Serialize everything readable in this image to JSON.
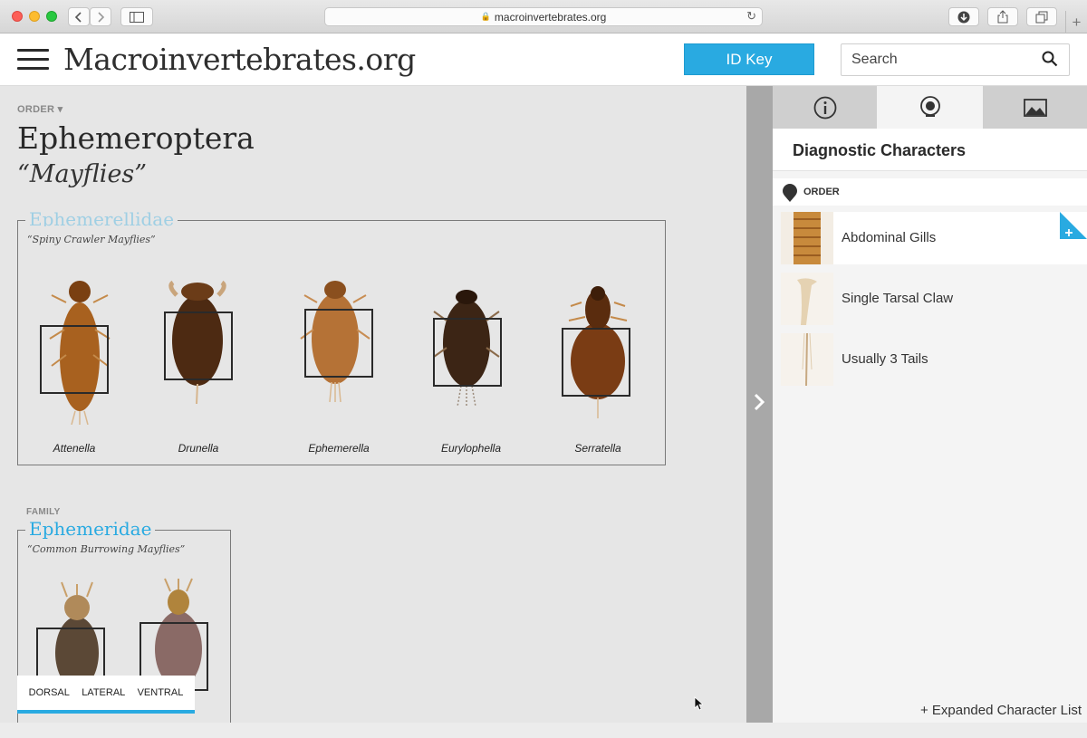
{
  "browser": {
    "url": "macroinvertebrates.org"
  },
  "header": {
    "site_title": "Macroinvertebrates.org",
    "id_key_label": "ID Key",
    "search_placeholder": "Search",
    "accent": "#29aae1"
  },
  "main": {
    "order_label": "ORDER",
    "order_name": "Ephemeroptera",
    "order_common": "“Mayflies”",
    "families": [
      {
        "label": "",
        "name": "Ephemerellidae",
        "common": "“Spiny Crawler Mayflies”",
        "genera": [
          "Attenella",
          "Drunella",
          "Ephemerella",
          "Eurylophella",
          "Serratella"
        ]
      },
      {
        "label": "FAMILY",
        "name": "Ephemeridae",
        "common": "“Common Burrowing Mayflies”"
      }
    ],
    "view_tabs": [
      "DORSAL",
      "LATERAL",
      "VENTRAL"
    ]
  },
  "panel": {
    "tabs": [
      "info-icon",
      "diagnostic-icon",
      "image-icon"
    ],
    "title": "Diagnostic Characters",
    "order_row_label": "ORDER",
    "characters": [
      {
        "name": "Abdominal Gills",
        "active": true
      },
      {
        "name": "Single Tarsal Claw",
        "active": false
      },
      {
        "name": "Usually 3 Tails",
        "active": false
      }
    ],
    "expanded_link": "+ Expanded Character List"
  }
}
